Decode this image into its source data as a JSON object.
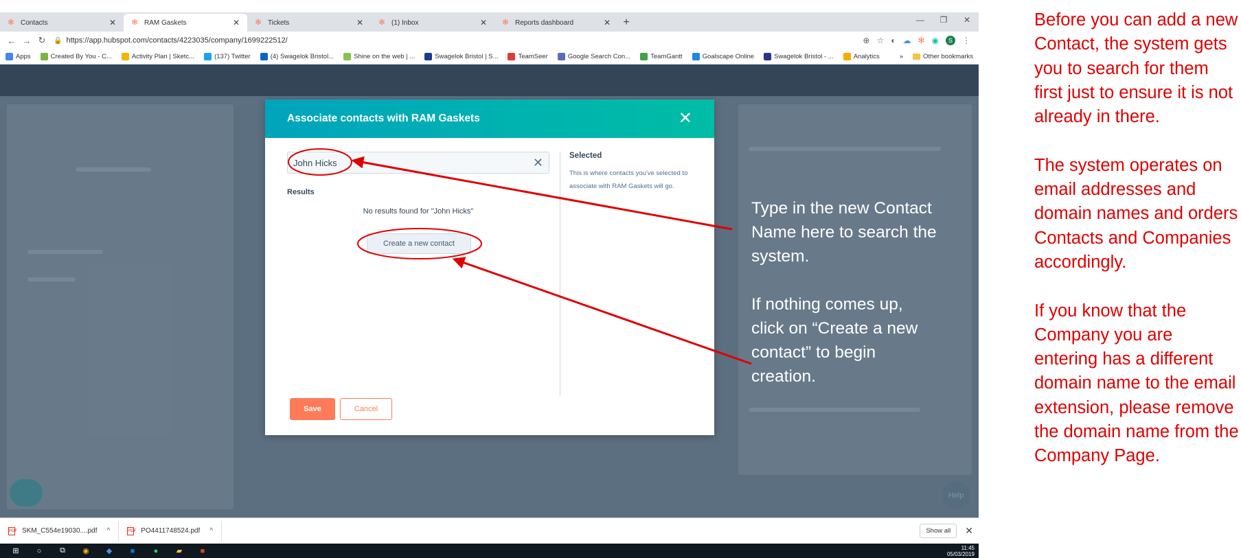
{
  "browser": {
    "tabs": [
      {
        "title": "Contacts",
        "active": false
      },
      {
        "title": "RAM Gaskets",
        "active": true
      },
      {
        "title": "Tickets",
        "active": false
      },
      {
        "title": "(1) Inbox",
        "active": false
      },
      {
        "title": "Reports dashboard",
        "active": false
      }
    ],
    "new_tab": "+",
    "url": "https://app.hubspot.com/contacts/4223035/company/1699222512/",
    "profile_initial": "S",
    "bookmarks": [
      {
        "label": "Apps",
        "color": "#4285f4"
      },
      {
        "label": "Created By You - C...",
        "color": "#7cb342"
      },
      {
        "label": "Activity Plan | Sketc...",
        "color": "#f4b400"
      },
      {
        "label": "(137) Twitter",
        "color": "#1da1f2"
      },
      {
        "label": "(4) Swagelok Bristol...",
        "color": "#0a66c2"
      },
      {
        "label": "Shine on the web | ...",
        "color": "#8bc34a"
      },
      {
        "label": "Swagelok Bristol | S...",
        "color": "#1a3c8f"
      },
      {
        "label": "TeamSeer",
        "color": "#e53935"
      },
      {
        "label": "Google Search Con...",
        "color": "#5c6bc0"
      },
      {
        "label": "TeamGantt",
        "color": "#43a047"
      },
      {
        "label": "Goalscape Online",
        "color": "#1e88e5"
      },
      {
        "label": "Swagelok Bristol - ...",
        "color": "#283593"
      },
      {
        "label": "Analytics",
        "color": "#f9ab00"
      }
    ],
    "bookmarks_overflow": "»",
    "other_bookmarks": "Other bookmarks"
  },
  "modal": {
    "title": "Associate contacts with RAM Gaskets",
    "search_value": "John Hicks",
    "results_label": "Results",
    "no_results_text": "No results found for \"John Hicks\"",
    "create_button": "Create a new contact",
    "selected_title": "Selected",
    "selected_description": "This is where contacts you've selected to associate with RAM Gaskets will go.",
    "save_button": "Save",
    "cancel_button": "Cancel"
  },
  "app": {
    "help_label": "Help"
  },
  "callout": {
    "paragraphs": [
      "Type in the new Contact Name here to search the system.",
      "If nothing comes up, click on “Create a new contact” to begin creation."
    ]
  },
  "downloads": {
    "items": [
      {
        "name": "SKM_C554e19030....pdf"
      },
      {
        "name": "PO4411748524.pdf"
      }
    ],
    "show_all": "Show all"
  },
  "taskbar": {
    "time": "11:45",
    "date": "05/03/2019"
  },
  "notes": {
    "paragraphs": [
      "Before you can add a new Contact, the system gets you to search for them first just to ensure it is not already in there.",
      "The system operates on email addresses and domain names and orders Contacts and Companies accordingly.",
      "If you know that the Company you are entering has a different domain name to the email extension, please remove the domain name from the Company Page."
    ]
  },
  "colors": {
    "annotation_red": "#e00000",
    "hubspot_orange": "#ff7a59",
    "modal_header_teal": "#00a4bd"
  }
}
